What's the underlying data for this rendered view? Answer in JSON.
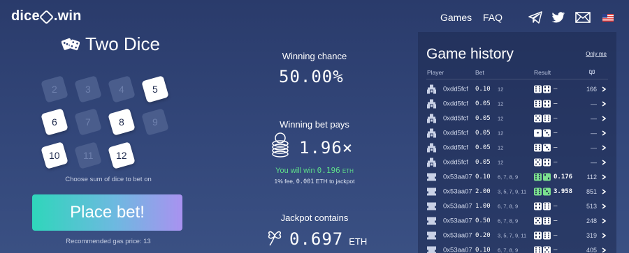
{
  "header": {
    "logo_left": "dice",
    "logo_right": ".win",
    "nav": [
      {
        "label": "Games"
      },
      {
        "label": "FAQ"
      }
    ],
    "icons": [
      "telegram-icon",
      "twitter-icon",
      "mail-icon",
      "us-flag-icon"
    ]
  },
  "game": {
    "title": "Two Dice",
    "cards": [
      {
        "value": "2",
        "selected": false
      },
      {
        "value": "3",
        "selected": false
      },
      {
        "value": "4",
        "selected": false
      },
      {
        "value": "5",
        "selected": true
      },
      {
        "value": "6",
        "selected": true
      },
      {
        "value": "7",
        "selected": false
      },
      {
        "value": "8",
        "selected": true
      },
      {
        "value": "9",
        "selected": false
      },
      {
        "value": "10",
        "selected": true
      },
      {
        "value": "11",
        "selected": false
      },
      {
        "value": "12",
        "selected": true
      }
    ],
    "choose_caption": "Choose sum of dice to bet on",
    "place_bet_label": "Place bet!",
    "gas_price_text": "Recommended gas price: 13"
  },
  "stats": {
    "winning_chance_label": "Winning chance",
    "winning_chance_value": "50.00%",
    "winning_bet_pays_label": "Winning bet pays",
    "winning_bet_pays_value": "1.96×",
    "you_will_win_prefix": "You will win",
    "you_will_win_amount": "0.196",
    "you_will_win_unit": "ETH",
    "fee_prefix": "1% fee,",
    "fee_amount": "0.001",
    "fee_suffix": "ETH to jackpot",
    "jackpot_label": "Jackpot contains",
    "jackpot_value": "0.697",
    "jackpot_unit": "ETH"
  },
  "history": {
    "title": "Game history",
    "only_me": "Only me",
    "columns": {
      "player": "Player",
      "bet": "Bet",
      "result": "Result"
    },
    "rows": [
      {
        "player": "0xdd5fcf",
        "bet": "0.10",
        "nums": "12",
        "dice": [
          6,
          4
        ],
        "win": false,
        "result": "—",
        "jackpot": "166"
      },
      {
        "player": "0xdd5fcf",
        "bet": "0.05",
        "nums": "12",
        "dice": [
          6,
          4
        ],
        "win": false,
        "result": "—",
        "jackpot": "—"
      },
      {
        "player": "0xdd5fcf",
        "bet": "0.05",
        "nums": "12",
        "dice": [
          5,
          6
        ],
        "win": false,
        "result": "—",
        "jackpot": "—"
      },
      {
        "player": "0xdd5fcf",
        "bet": "0.05",
        "nums": "12",
        "dice": [
          1,
          3
        ],
        "win": false,
        "result": "—",
        "jackpot": "—"
      },
      {
        "player": "0xdd5fcf",
        "bet": "0.05",
        "nums": "12",
        "dice": [
          6,
          3
        ],
        "win": false,
        "result": "—",
        "jackpot": "—"
      },
      {
        "player": "0xdd5fcf",
        "bet": "0.05",
        "nums": "12",
        "dice": [
          5,
          4
        ],
        "win": false,
        "result": "—",
        "jackpot": "—"
      },
      {
        "player": "0x53aa07",
        "bet": "0.10",
        "nums": "6, 7, 8, 9",
        "dice": [
          6,
          2
        ],
        "win": true,
        "result": "0.176",
        "jackpot": "112"
      },
      {
        "player": "0x53aa07",
        "bet": "2.00",
        "nums": "3, 5, 7, 9, 11",
        "dice": [
          6,
          3
        ],
        "win": true,
        "result": "3.958",
        "jackpot": "851"
      },
      {
        "player": "0x53aa07",
        "bet": "1.00",
        "nums": "6, 7, 8, 9",
        "dice": [
          4,
          6
        ],
        "win": false,
        "result": "—",
        "jackpot": "513"
      },
      {
        "player": "0x53aa07",
        "bet": "0.50",
        "nums": "6, 7, 8, 9",
        "dice": [
          5,
          6
        ],
        "win": false,
        "result": "—",
        "jackpot": "248"
      },
      {
        "player": "0x53aa07",
        "bet": "0.20",
        "nums": "3, 5, 7, 9, 11",
        "dice": [
          4,
          6
        ],
        "win": false,
        "result": "—",
        "jackpot": "319"
      },
      {
        "player": "0x53aa07",
        "bet": "0.10",
        "nums": "6, 7, 8, 9",
        "dice": [
          6,
          5
        ],
        "win": false,
        "result": "—",
        "jackpot": "405"
      }
    ]
  },
  "colors": {
    "background": "#2f4275",
    "win_green": "#5fe08a",
    "card_off": "#4a5d8c"
  }
}
